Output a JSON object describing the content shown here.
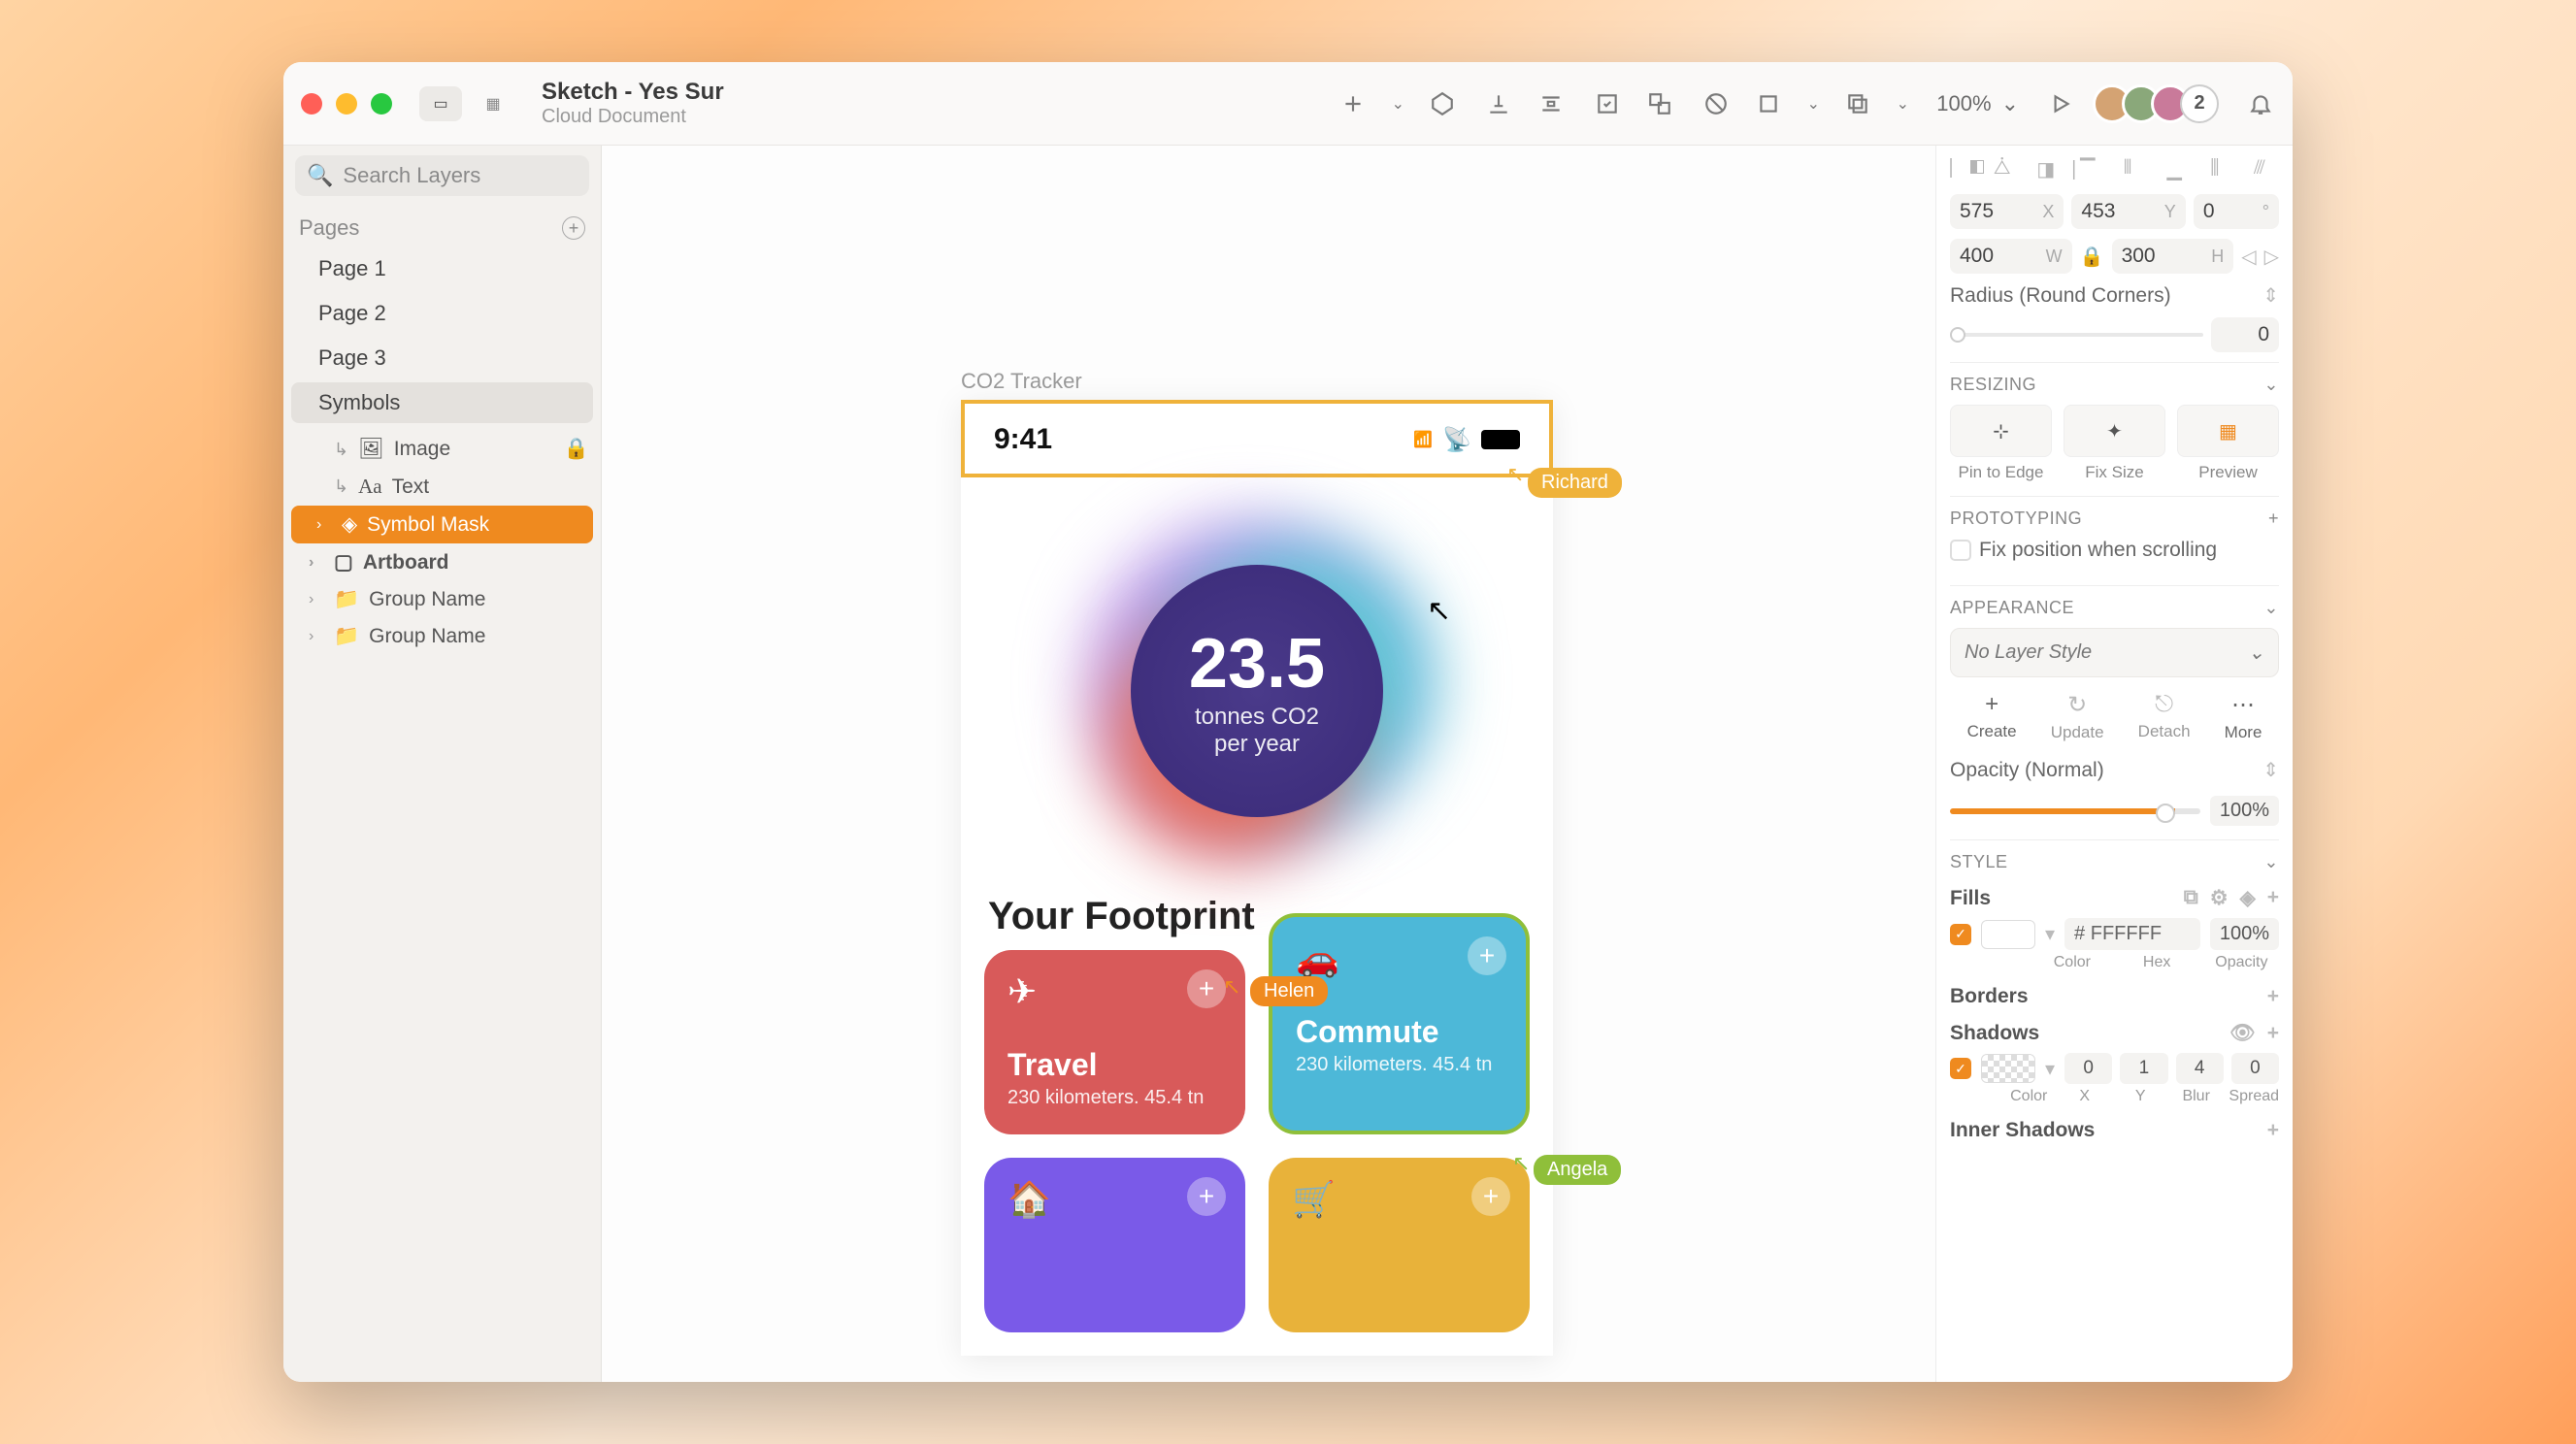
{
  "doc": {
    "title": "Sketch - Yes Sur",
    "subtitle": "Cloud Document"
  },
  "zoom": "100%",
  "avatar_extra": "2",
  "sidebar": {
    "search_placeholder": "Search Layers",
    "pages_label": "Pages",
    "pages": [
      "Page 1",
      "Page 2",
      "Page 3",
      "Symbols"
    ],
    "layers": {
      "image": "Image",
      "text": "Text",
      "symbol_mask": "Symbol Mask",
      "artboard": "Artboard",
      "group1": "Group Name",
      "group2": "Group Name"
    }
  },
  "canvas": {
    "artboard_name": "CO2 Tracker",
    "status_time": "9:41",
    "gauge_value": "23.5",
    "gauge_unit": "tonnes CO2",
    "gauge_per": "per year",
    "footprint_title": "Your Footprint",
    "cards": {
      "travel": {
        "title": "Travel",
        "meta": "230 kilometers. 45.4 tn"
      },
      "commute": {
        "title": "Commute",
        "meta": "230 kilometers. 45.4 tn"
      }
    },
    "collab": {
      "richard": "Richard",
      "helen": "Helen",
      "angela": "Angela"
    }
  },
  "inspector": {
    "x": "575",
    "y": "453",
    "rot": "0",
    "w": "400",
    "h": "300",
    "radius_label": "Radius (Round Corners)",
    "radius": "0",
    "resizing": "RESIZING",
    "pin": "Pin to Edge",
    "fix": "Fix Size",
    "preview": "Preview",
    "prototyping": "PROTOTYPING",
    "fix_scroll": "Fix position when scrolling",
    "appearance": "APPEARANCE",
    "layer_style": "No Layer Style",
    "create": "Create",
    "update": "Update",
    "detach": "Detach",
    "more": "More",
    "opacity_label": "Opacity (Normal)",
    "opacity_val": "100%",
    "style": "STYLE",
    "fills": "Fills",
    "borders": "Borders",
    "shadows": "Shadows",
    "inner_shadows": "Inner Shadows",
    "hex_prefix": "#",
    "hex": "FFFFFF",
    "fill_opacity": "100%",
    "color_lbl": "Color",
    "hex_lbl": "Hex",
    "op_lbl": "Opacity",
    "sx": "0",
    "sy": "1",
    "sblur": "4",
    "sspread": "0",
    "x_lbl": "X",
    "y_lbl": "Y",
    "blur_lbl": "Blur",
    "spread_lbl": "Spread",
    "w_lbl": "W",
    "h_lbl": "H",
    "rot_lbl": "°"
  }
}
